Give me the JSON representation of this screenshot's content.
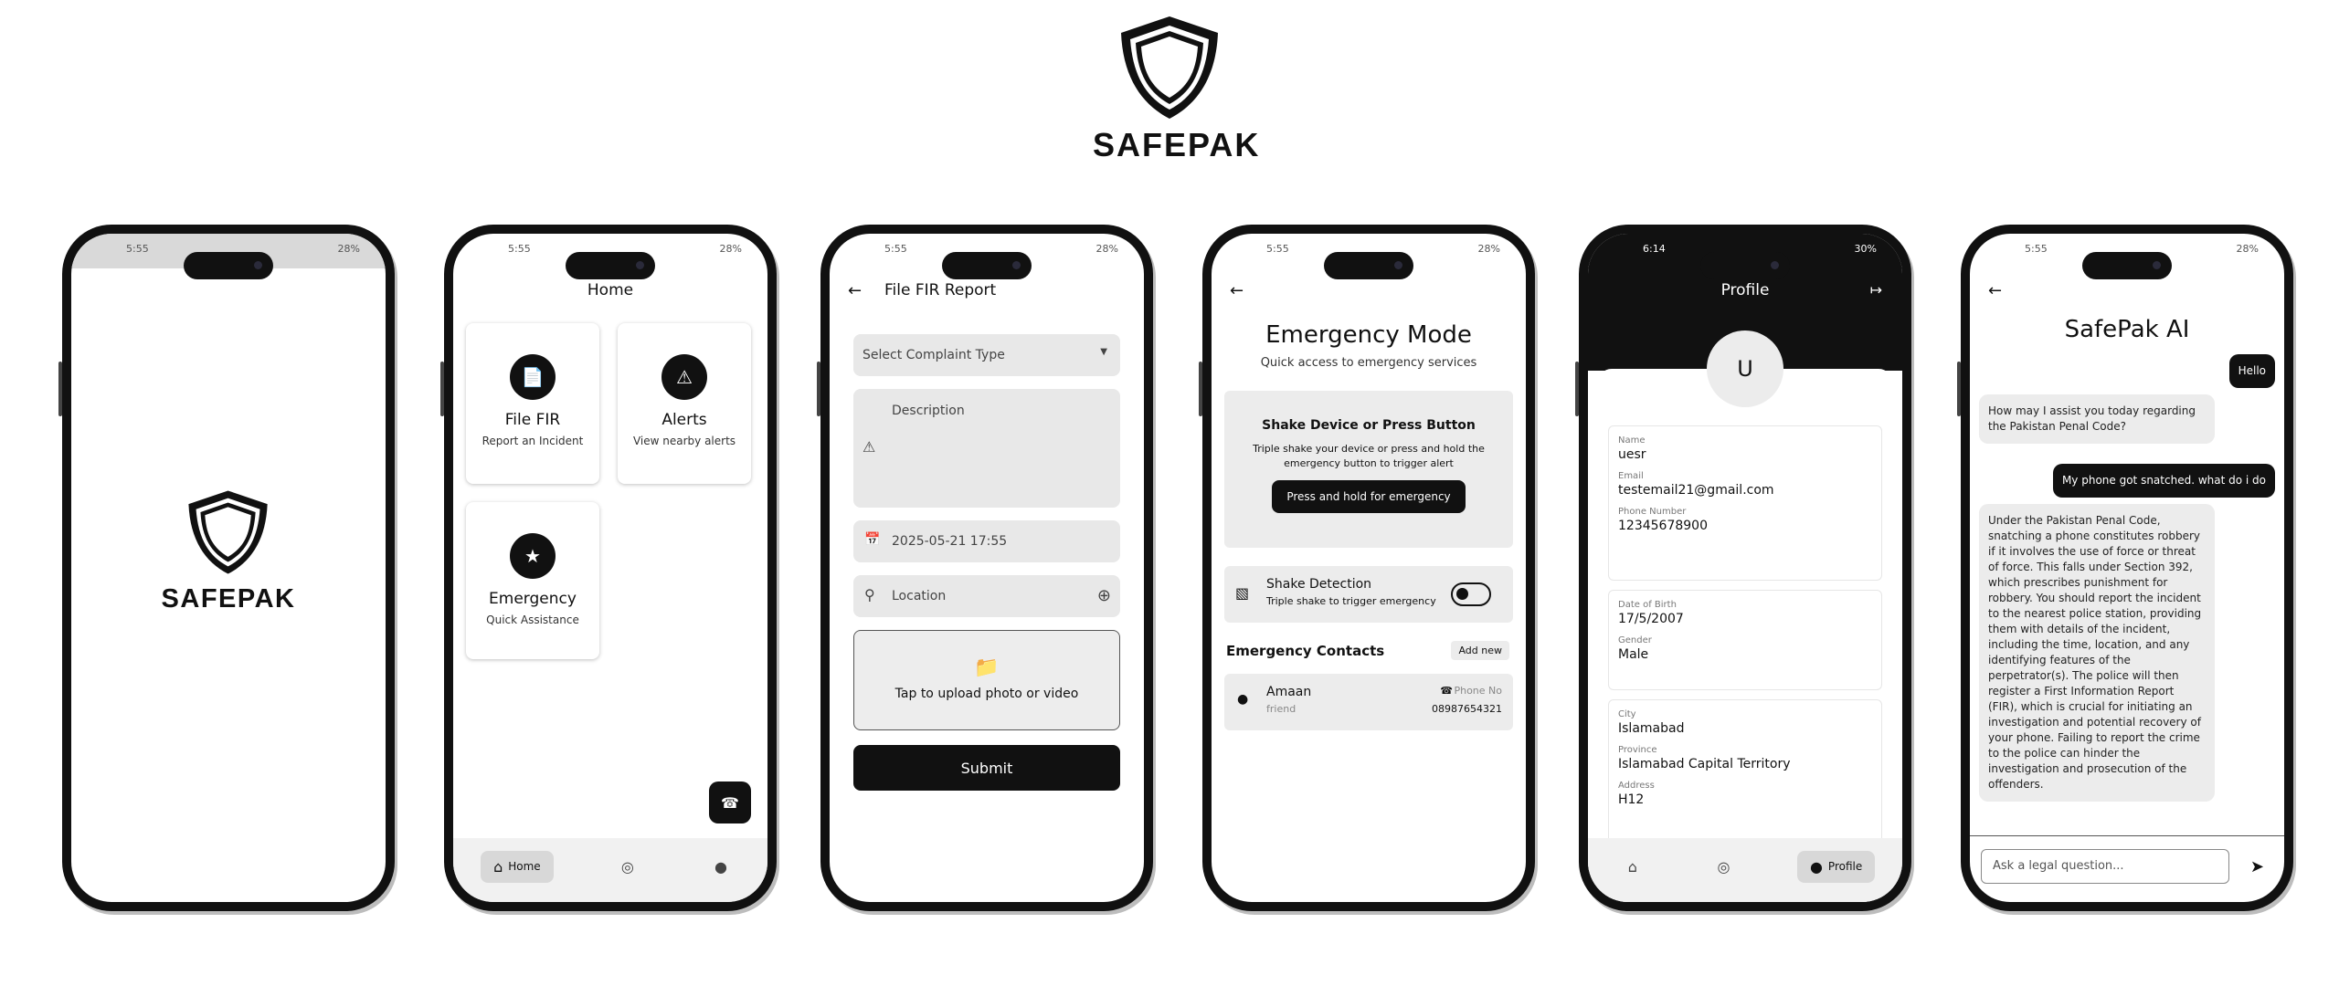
{
  "brand": {
    "name": "SAFEPAK"
  },
  "status_bar": {
    "p1": {
      "time": "5:55",
      "right": "28%"
    },
    "p2": {
      "time": "5:55",
      "right": "28%"
    },
    "p3": {
      "time": "5:55",
      "right": "28%"
    },
    "p4": {
      "time": "5:55",
      "right": "28%"
    },
    "p5": {
      "time": "6:14",
      "right": "30%"
    },
    "p6": {
      "time": "5:55",
      "right": "28%"
    }
  },
  "home": {
    "title": "Home",
    "cards": [
      {
        "title": "File FIR",
        "subtitle": "Report an Incident",
        "icon": "document-icon"
      },
      {
        "title": "Alerts",
        "subtitle": "View nearby alerts",
        "icon": "warning-icon"
      },
      {
        "title": "Emergency",
        "subtitle": "Quick Assistance",
        "icon": "shield-star-icon"
      }
    ],
    "nav": {
      "home": "Home",
      "profile": "Profile"
    }
  },
  "fir": {
    "title": "File FIR Report",
    "complaint_placeholder": "Select Complaint Type",
    "description_placeholder": "Description",
    "datetime": "2025-05-21 17:55",
    "location_placeholder": "Location",
    "upload_label": "Tap to upload photo or video",
    "submit": "Submit"
  },
  "emergency": {
    "title": "Emergency Mode",
    "subtitle": "Quick access to emergency services",
    "shake_title": "Shake Device or Press Button",
    "shake_desc": "Triple shake your device or press and hold the emergency button to trigger alert",
    "hold_button": "Press and hold for emergency",
    "detection_title": "Shake Detection",
    "detection_desc": "Triple shake to trigger emergency",
    "contacts_title": "Emergency Contacts",
    "add_new": "Add new",
    "contact": {
      "name": "Amaan",
      "relation": "friend",
      "phone_label": "Phone No",
      "phone": "08987654321"
    }
  },
  "profile": {
    "title": "Profile",
    "avatar_letter": "U",
    "fields": {
      "name_label": "Name",
      "name": "uesr",
      "email_label": "Email",
      "email": "testemail21@gmail.com",
      "phone_label": "Phone Number",
      "phone": "12345678900",
      "dob_label": "Date of Birth",
      "dob": "17/5/2007",
      "gender_label": "Gender",
      "gender": "Male",
      "city_label": "City",
      "city": "Islamabad",
      "province_label": "Province",
      "province": "Islamabad Capital Territory",
      "address_label": "Address",
      "address": "H12"
    }
  },
  "chat": {
    "title": "SafePak AI",
    "messages": [
      {
        "role": "user",
        "text": "Hello"
      },
      {
        "role": "ai",
        "text": "How may I assist you today regarding the Pakistan Penal Code?"
      },
      {
        "role": "user",
        "text": "My phone got snatched. what do i do"
      },
      {
        "role": "ai",
        "text": "Under the Pakistan Penal Code, snatching a phone constitutes robbery if it involves the use of force or threat of force. This falls under Section 392, which prescribes punishment for robbery. You should report the incident to the nearest police station, providing them with details of the incident, including the time, location, and any identifying features of the perpetrator(s). The police will then register a First Information Report (FIR), which is crucial for initiating an investigation and potential recovery of your phone. Failing to report the crime to the police can hinder the investigation and prosecution of the offenders."
      }
    ],
    "input_placeholder": "Ask a legal question..."
  }
}
